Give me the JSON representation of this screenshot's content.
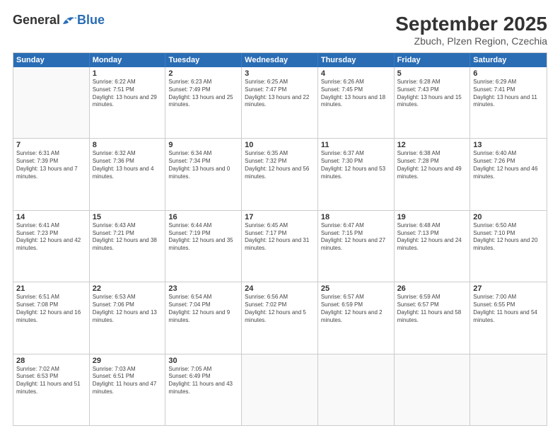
{
  "logo": {
    "general": "General",
    "blue": "Blue"
  },
  "title": "September 2025",
  "location": "Zbuch, Plzen Region, Czechia",
  "header_days": [
    "Sunday",
    "Monday",
    "Tuesday",
    "Wednesday",
    "Thursday",
    "Friday",
    "Saturday"
  ],
  "weeks": [
    [
      {
        "day": "",
        "empty": true
      },
      {
        "day": "1",
        "sunrise": "6:22 AM",
        "sunset": "7:51 PM",
        "daylight": "13 hours and 29 minutes."
      },
      {
        "day": "2",
        "sunrise": "6:23 AM",
        "sunset": "7:49 PM",
        "daylight": "13 hours and 25 minutes."
      },
      {
        "day": "3",
        "sunrise": "6:25 AM",
        "sunset": "7:47 PM",
        "daylight": "13 hours and 22 minutes."
      },
      {
        "day": "4",
        "sunrise": "6:26 AM",
        "sunset": "7:45 PM",
        "daylight": "13 hours and 18 minutes."
      },
      {
        "day": "5",
        "sunrise": "6:28 AM",
        "sunset": "7:43 PM",
        "daylight": "13 hours and 15 minutes."
      },
      {
        "day": "6",
        "sunrise": "6:29 AM",
        "sunset": "7:41 PM",
        "daylight": "13 hours and 11 minutes."
      }
    ],
    [
      {
        "day": "7",
        "sunrise": "6:31 AM",
        "sunset": "7:39 PM",
        "daylight": "13 hours and 7 minutes."
      },
      {
        "day": "8",
        "sunrise": "6:32 AM",
        "sunset": "7:36 PM",
        "daylight": "13 hours and 4 minutes."
      },
      {
        "day": "9",
        "sunrise": "6:34 AM",
        "sunset": "7:34 PM",
        "daylight": "13 hours and 0 minutes."
      },
      {
        "day": "10",
        "sunrise": "6:35 AM",
        "sunset": "7:32 PM",
        "daylight": "12 hours and 56 minutes."
      },
      {
        "day": "11",
        "sunrise": "6:37 AM",
        "sunset": "7:30 PM",
        "daylight": "12 hours and 53 minutes."
      },
      {
        "day": "12",
        "sunrise": "6:38 AM",
        "sunset": "7:28 PM",
        "daylight": "12 hours and 49 minutes."
      },
      {
        "day": "13",
        "sunrise": "6:40 AM",
        "sunset": "7:26 PM",
        "daylight": "12 hours and 46 minutes."
      }
    ],
    [
      {
        "day": "14",
        "sunrise": "6:41 AM",
        "sunset": "7:23 PM",
        "daylight": "12 hours and 42 minutes."
      },
      {
        "day": "15",
        "sunrise": "6:43 AM",
        "sunset": "7:21 PM",
        "daylight": "12 hours and 38 minutes."
      },
      {
        "day": "16",
        "sunrise": "6:44 AM",
        "sunset": "7:19 PM",
        "daylight": "12 hours and 35 minutes."
      },
      {
        "day": "17",
        "sunrise": "6:45 AM",
        "sunset": "7:17 PM",
        "daylight": "12 hours and 31 minutes."
      },
      {
        "day": "18",
        "sunrise": "6:47 AM",
        "sunset": "7:15 PM",
        "daylight": "12 hours and 27 minutes."
      },
      {
        "day": "19",
        "sunrise": "6:48 AM",
        "sunset": "7:13 PM",
        "daylight": "12 hours and 24 minutes."
      },
      {
        "day": "20",
        "sunrise": "6:50 AM",
        "sunset": "7:10 PM",
        "daylight": "12 hours and 20 minutes."
      }
    ],
    [
      {
        "day": "21",
        "sunrise": "6:51 AM",
        "sunset": "7:08 PM",
        "daylight": "12 hours and 16 minutes."
      },
      {
        "day": "22",
        "sunrise": "6:53 AM",
        "sunset": "7:06 PM",
        "daylight": "12 hours and 13 minutes."
      },
      {
        "day": "23",
        "sunrise": "6:54 AM",
        "sunset": "7:04 PM",
        "daylight": "12 hours and 9 minutes."
      },
      {
        "day": "24",
        "sunrise": "6:56 AM",
        "sunset": "7:02 PM",
        "daylight": "12 hours and 5 minutes."
      },
      {
        "day": "25",
        "sunrise": "6:57 AM",
        "sunset": "6:59 PM",
        "daylight": "12 hours and 2 minutes."
      },
      {
        "day": "26",
        "sunrise": "6:59 AM",
        "sunset": "6:57 PM",
        "daylight": "11 hours and 58 minutes."
      },
      {
        "day": "27",
        "sunrise": "7:00 AM",
        "sunset": "6:55 PM",
        "daylight": "11 hours and 54 minutes."
      }
    ],
    [
      {
        "day": "28",
        "sunrise": "7:02 AM",
        "sunset": "6:53 PM",
        "daylight": "11 hours and 51 minutes."
      },
      {
        "day": "29",
        "sunrise": "7:03 AM",
        "sunset": "6:51 PM",
        "daylight": "11 hours and 47 minutes."
      },
      {
        "day": "30",
        "sunrise": "7:05 AM",
        "sunset": "6:49 PM",
        "daylight": "11 hours and 43 minutes."
      },
      {
        "day": "",
        "empty": true
      },
      {
        "day": "",
        "empty": true
      },
      {
        "day": "",
        "empty": true
      },
      {
        "day": "",
        "empty": true
      }
    ]
  ]
}
